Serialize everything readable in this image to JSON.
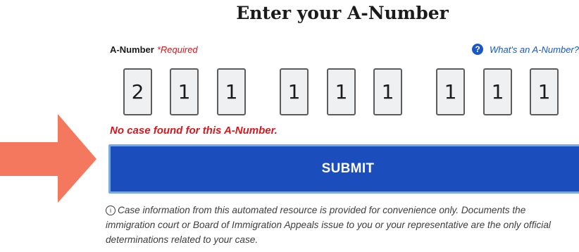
{
  "heading": "Enter your A-Number",
  "field": {
    "label": "A-Number",
    "required": "*Required",
    "help_link": "What's an A-Number?",
    "help_icon": "question-circle-icon",
    "digits": [
      "2",
      "1",
      "1",
      "1",
      "1",
      "1",
      "1",
      "1",
      "1"
    ]
  },
  "error_message": "No case found for this A-Number.",
  "submit_label": "SUBMIT",
  "info_icon": "info-circle-icon",
  "info_text": "Case information from this automated resource is provided for convenience only. Documents the immigration court or Board of Immigration Appeals issue to you or your representative are the only official determinations related to your case.",
  "colors": {
    "accent": "#1b4dbd",
    "error": "#d4181e",
    "link": "#1a56c5",
    "arrow": "#f4785e"
  }
}
